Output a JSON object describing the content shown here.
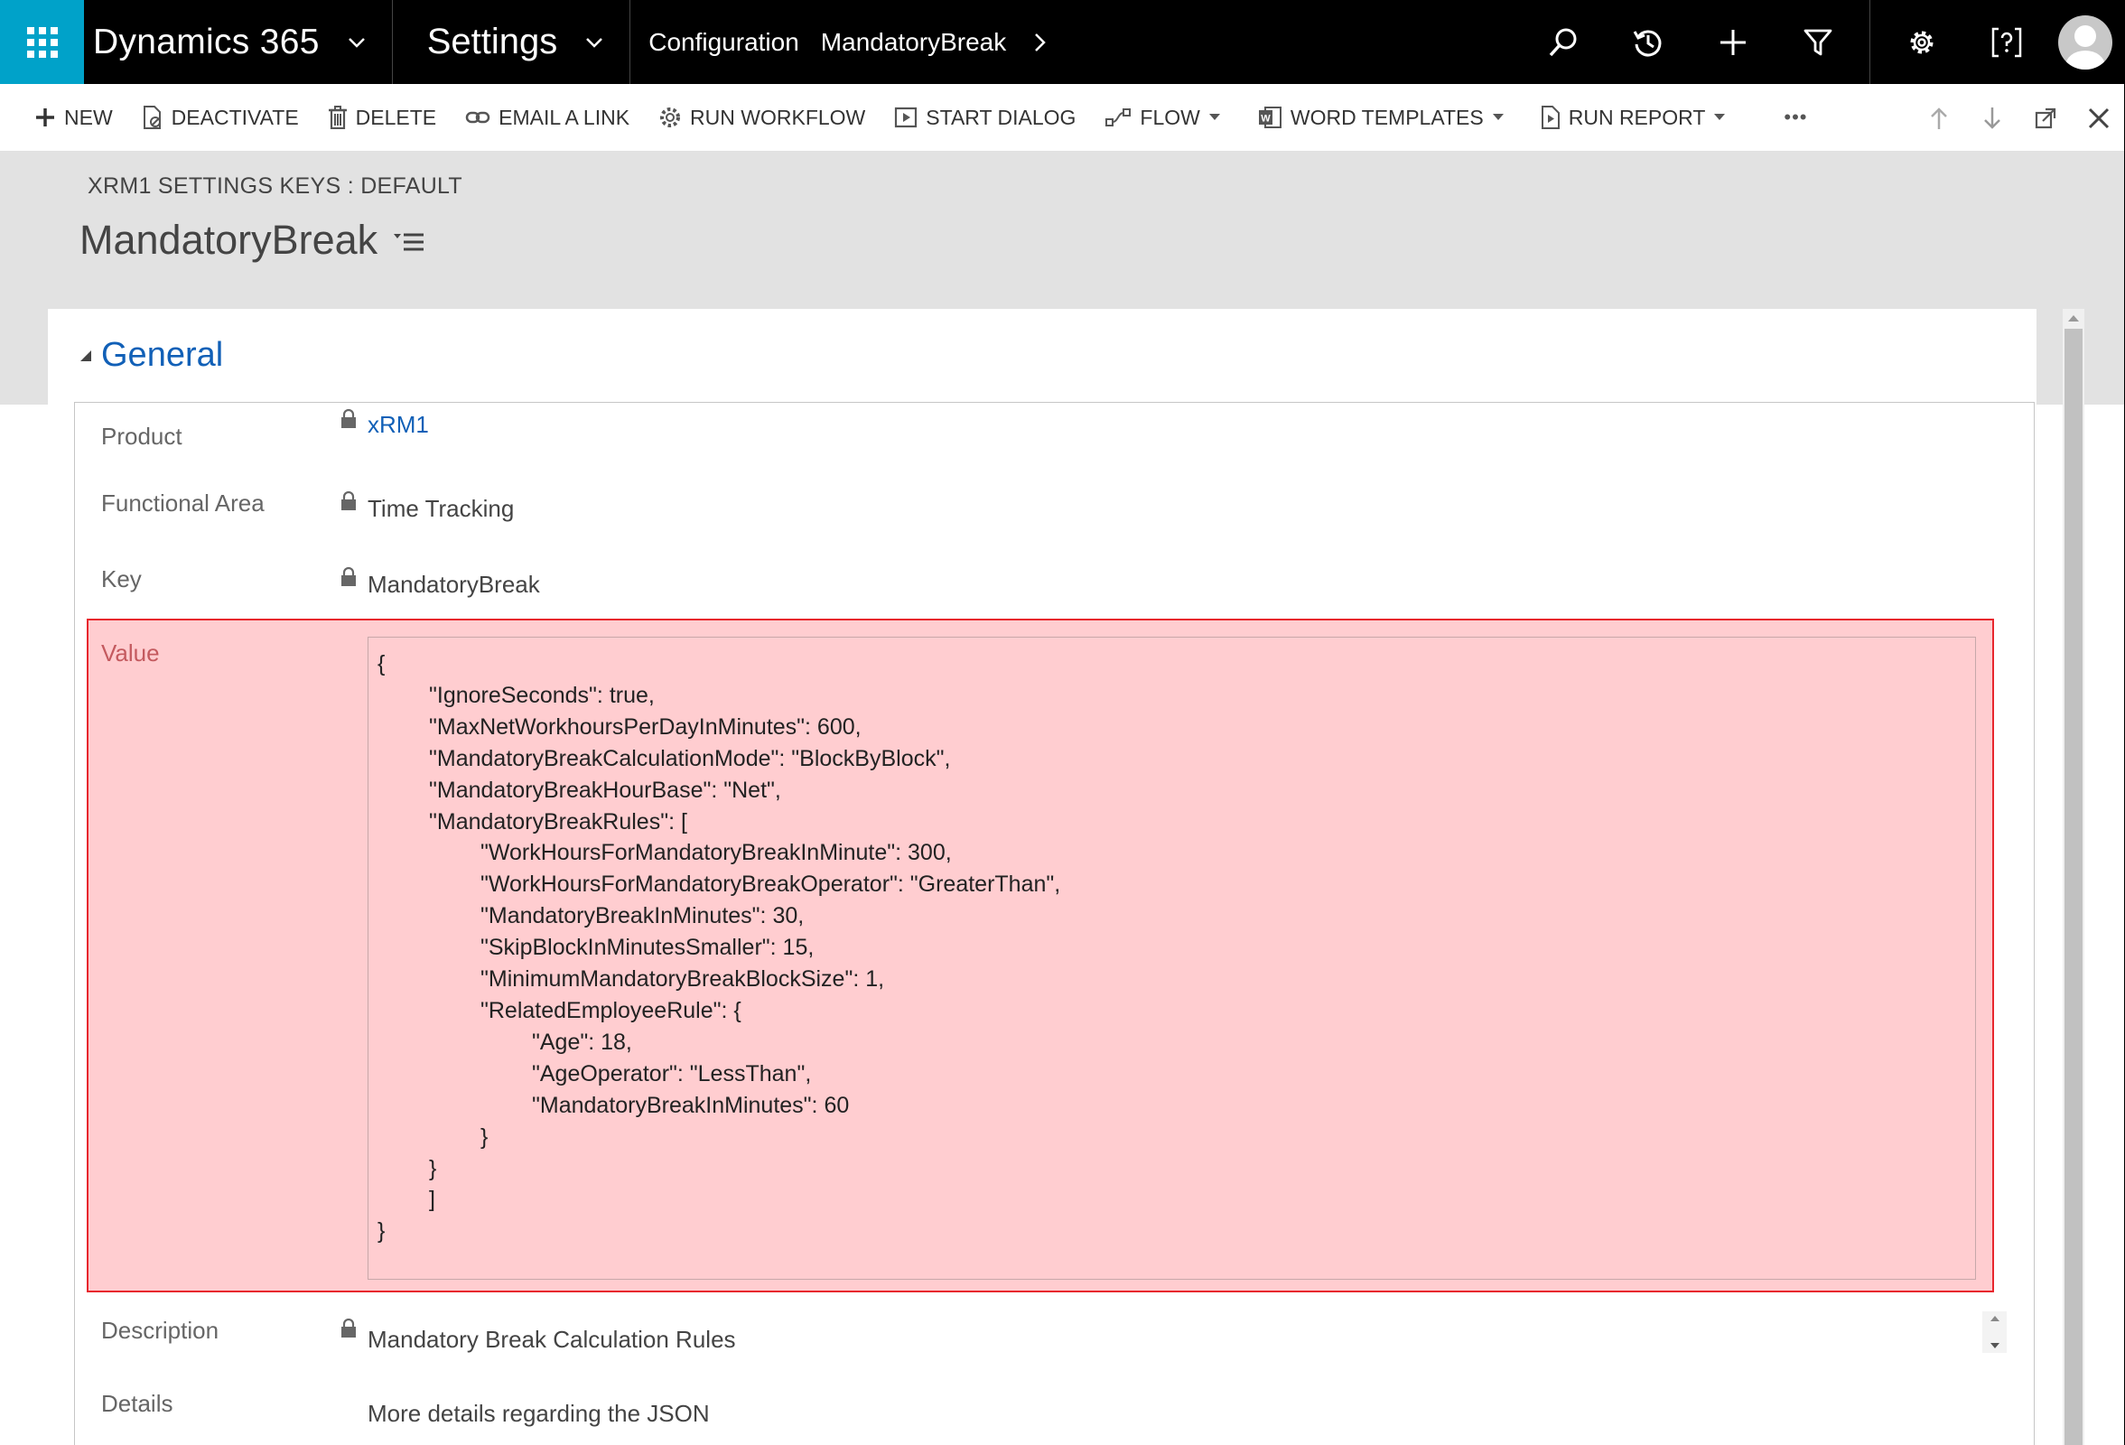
{
  "nav": {
    "app_title": "Dynamics 365",
    "area_title": "Settings",
    "breadcrumbs": [
      "Configuration",
      "MandatoryBreak"
    ],
    "icons": [
      "app-launcher-icon",
      "search-icon",
      "history-icon",
      "plus-icon",
      "filter-icon",
      "gear-icon",
      "help-icon",
      "user-avatar-icon"
    ],
    "accent_color": "#00a2c9"
  },
  "commandbar": {
    "new": "NEW",
    "deactivate": "DEACTIVATE",
    "delete": "DELETE",
    "email_link": "EMAIL A LINK",
    "run_workflow": "RUN WORKFLOW",
    "start_dialog": "START DIALOG",
    "flow": "FLOW",
    "word_templates": "WORD TEMPLATES",
    "run_report": "RUN REPORT",
    "more": "•••"
  },
  "header": {
    "entity_label": "XRM1 SETTINGS KEYS : DEFAULT",
    "record_title": "MandatoryBreak"
  },
  "section": {
    "title": "General",
    "title_color": "#1160b7"
  },
  "fields": {
    "product": {
      "label": "Product",
      "value": "xRM1"
    },
    "functional_area": {
      "label": "Functional Area",
      "value": "Time Tracking"
    },
    "key": {
      "label": "Key",
      "value": "MandatoryBreak"
    },
    "value": {
      "label": "Value",
      "text": "{\n\t\"IgnoreSeconds\": true,\n\t\"MaxNetWorkhoursPerDayInMinutes\": 600,\n\t\"MandatoryBreakCalculationMode\": \"BlockByBlock\",\n\t\"MandatoryBreakHourBase\": \"Net\",\n\t\"MandatoryBreakRules\": [\n\t\t\"WorkHoursForMandatoryBreakInMinute\": 300,\n\t\t\"WorkHoursForMandatoryBreakOperator\": \"GreaterThan\",\n\t\t\"MandatoryBreakInMinutes\": 30,\n\t\t\"SkipBlockInMinutesSmaller\": 15,\n\t\t\"MinimumMandatoryBreakBlockSize\": 1,\n\t\t\"RelatedEmployeeRule\": {\n\t\t\t\"Age\": 18,\n\t\t\t\"AgeOperator\": \"LessThan\",\n\t\t\t\"MandatoryBreakInMinutes\": 60\n\t\t}\n\t}\n\t]\n}",
      "highlight_color": "#ffcdd0",
      "highlight_border": "#e8262d"
    },
    "description": {
      "label": "Description",
      "value": "Mandatory Break Calculation Rules"
    },
    "details": {
      "label": "Details",
      "value": "More details regarding the JSON"
    }
  }
}
